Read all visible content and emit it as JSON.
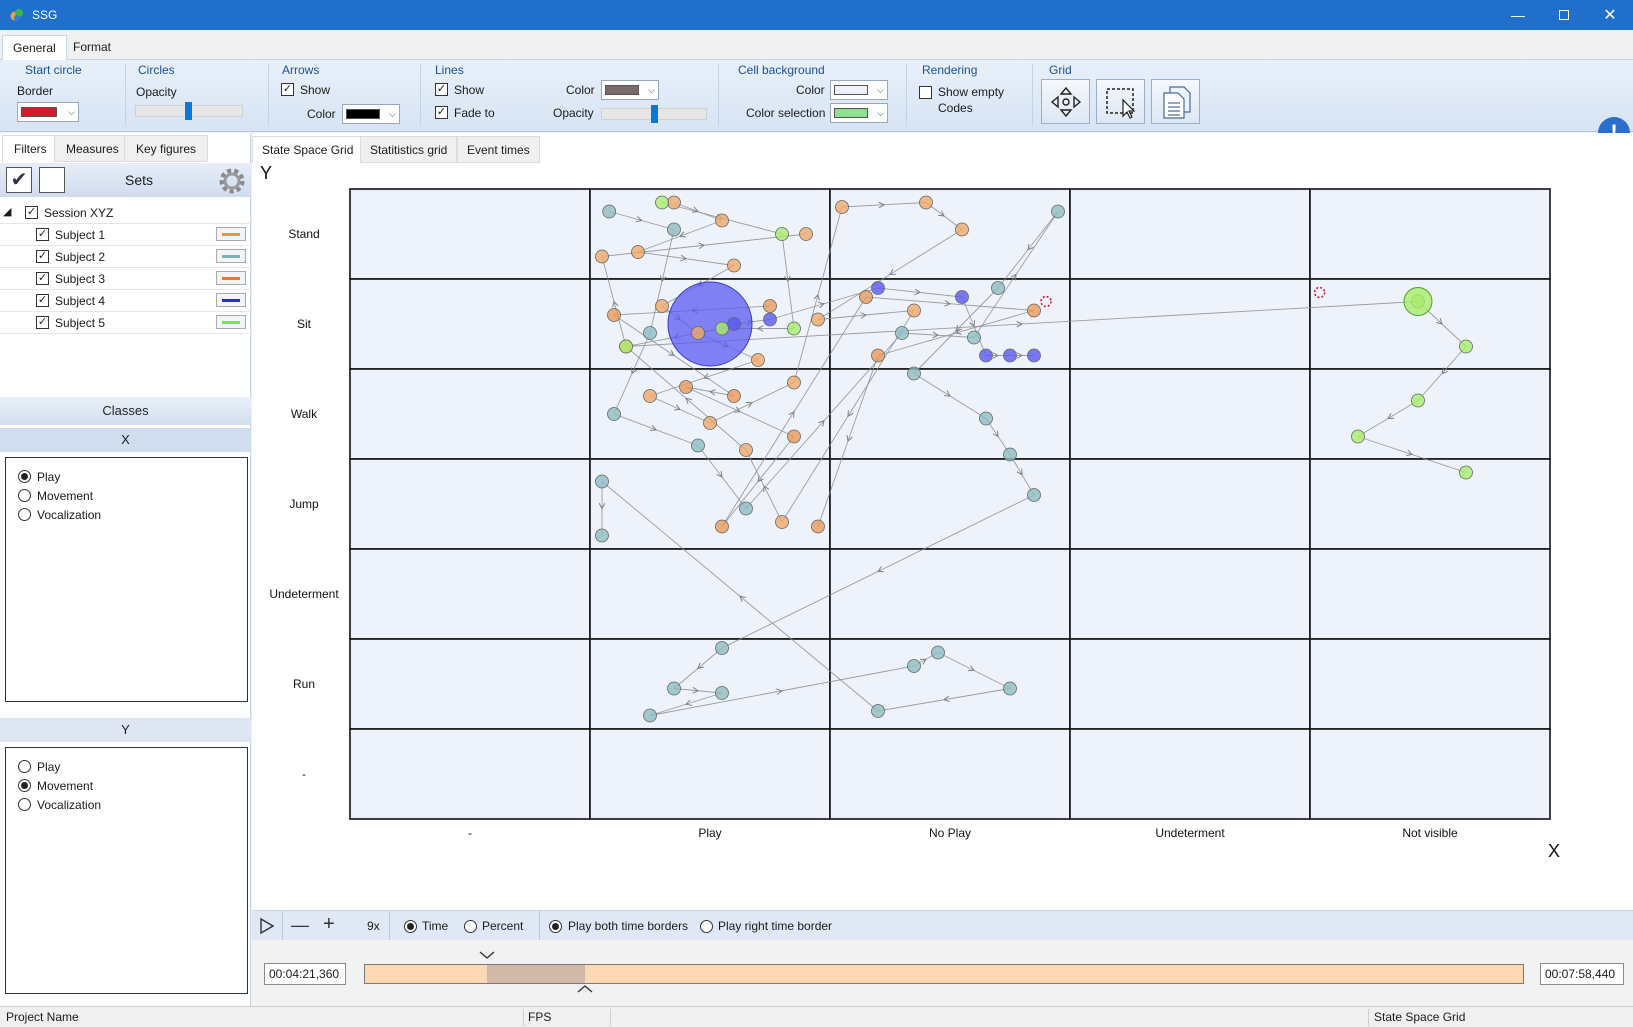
{
  "window": {
    "title": "SSG",
    "controls": [
      "minimize",
      "maximize",
      "close"
    ]
  },
  "ribbon_tabs": [
    {
      "label": "General",
      "active": true
    },
    {
      "label": "Format",
      "active": false
    }
  ],
  "ribbon": {
    "start_circle": {
      "title": "Start circle",
      "border_label": "Border",
      "border_color": "#d11a2a"
    },
    "circles": {
      "title": "Circles",
      "opacity_label": "Opacity",
      "opacity": 0.5
    },
    "arrows": {
      "title": "Arrows",
      "show_label": "Show",
      "show": true,
      "color_label": "Color",
      "color": "#000000"
    },
    "lines": {
      "title": "Lines",
      "show_label": "Show",
      "show": true,
      "fade_label": "Fade to",
      "fade": true,
      "color_label": "Color",
      "color": "#7b6a6a",
      "opacity_label": "Opacity",
      "opacity": 0.5
    },
    "cell_background": {
      "title": "Cell background",
      "color_label": "Color",
      "color": "#eef3fb",
      "selection_label": "Color selection",
      "selection_color": "#8fe08f"
    },
    "rendering": {
      "title": "Rendering",
      "show_empty_label": "Show empty Codes",
      "show_empty": false
    },
    "grid": {
      "title": "Grid",
      "buttons": [
        "move-arrows-icon",
        "select-cursor-icon",
        "copy-document-icon"
      ]
    },
    "info_icon": "exclamation-info-icon"
  },
  "left_tabs": [
    {
      "label": "Filters",
      "active": true
    },
    {
      "label": "Measures",
      "active": false
    },
    {
      "label": "Key figures",
      "active": false
    }
  ],
  "sets": {
    "title": "Sets",
    "session": "Session XYZ",
    "subjects": [
      {
        "label": "Subject 1",
        "checked": true,
        "color": "#e8943a"
      },
      {
        "label": "Subject 2",
        "checked": true,
        "color": "#7fb0b8"
      },
      {
        "label": "Subject 3",
        "checked": true,
        "color": "#e07a3a"
      },
      {
        "label": "Subject 4",
        "checked": true,
        "color": "#2b2bd6"
      },
      {
        "label": "Subject 5",
        "checked": true,
        "color": "#7ee04a"
      }
    ]
  },
  "classes": {
    "title": "Classes",
    "x": {
      "label": "X",
      "options": [
        "Play",
        "Movement",
        "Vocalization"
      ],
      "selected": "Play"
    },
    "y": {
      "label": "Y",
      "options": [
        "Play",
        "Movement",
        "Vocalization"
      ],
      "selected": "Movement"
    }
  },
  "main_tabs": [
    {
      "label": "State Space Grid",
      "active": true
    },
    {
      "label": "Statitistics grid",
      "active": false
    },
    {
      "label": "Event times",
      "active": false
    }
  ],
  "chart_data": {
    "type": "scatter",
    "xlabel": "X",
    "ylabel": "Y",
    "x_categories": [
      "-",
      "Play",
      "No Play",
      "Undeterment",
      "Not visible"
    ],
    "y_categories": [
      "Stand",
      "Sit",
      "Walk",
      "Jump",
      "Undeterment",
      "Run",
      "-"
    ],
    "series": [
      {
        "name": "Subject 1",
        "color": "#f0a86a",
        "points": [
          [
            1.35,
            0.15
          ],
          [
            1.55,
            0.35
          ],
          [
            1.2,
            0.7
          ],
          [
            1.6,
            0.85
          ],
          [
            1.3,
            1.3
          ],
          [
            1.45,
            1.6
          ],
          [
            1.7,
            1.9
          ],
          [
            1.25,
            2.3
          ],
          [
            1.5,
            2.6
          ],
          [
            1.85,
            2.15
          ],
          [
            2.05,
            0.2
          ],
          [
            2.4,
            0.15
          ],
          [
            2.55,
            0.45
          ],
          [
            1.95,
            1.45
          ],
          [
            2.35,
            1.35
          ],
          [
            1.8,
            3.7
          ],
          [
            1.65,
            2.9
          ],
          [
            1.15,
            1.75
          ],
          [
            1.05,
            0.75
          ],
          [
            1.9,
            0.5
          ]
        ]
      },
      {
        "name": "Subject 2",
        "color": "#8fbcc2",
        "points": [
          [
            1.08,
            0.25
          ],
          [
            1.35,
            0.45
          ],
          [
            1.25,
            1.6
          ],
          [
            1.1,
            2.5
          ],
          [
            1.45,
            2.85
          ],
          [
            1.65,
            3.55
          ],
          [
            2.3,
            1.6
          ],
          [
            2.6,
            1.65
          ],
          [
            2.95,
            0.25
          ],
          [
            2.7,
            1.1
          ],
          [
            2.35,
            2.05
          ],
          [
            2.65,
            2.55
          ],
          [
            2.75,
            2.95
          ],
          [
            2.85,
            3.4
          ],
          [
            1.55,
            5.1
          ],
          [
            1.35,
            5.55
          ],
          [
            1.55,
            5.6
          ],
          [
            1.25,
            5.85
          ],
          [
            2.35,
            5.3
          ],
          [
            2.45,
            5.15
          ],
          [
            2.75,
            5.55
          ],
          [
            2.2,
            5.8
          ],
          [
            1.05,
            3.25
          ],
          [
            1.05,
            3.85
          ]
        ]
      },
      {
        "name": "Subject 3",
        "color": "#e89a5a",
        "points": [
          [
            1.75,
            1.3
          ],
          [
            1.1,
            1.4
          ],
          [
            1.6,
            2.3
          ],
          [
            1.4,
            2.2
          ],
          [
            1.85,
            2.75
          ],
          [
            1.55,
            3.75
          ],
          [
            2.15,
            1.2
          ],
          [
            2.85,
            1.35
          ],
          [
            2.2,
            1.85
          ],
          [
            1.95,
            3.75
          ]
        ]
      },
      {
        "name": "Subject 4",
        "color": "#5a5af0",
        "points": [
          [
            1.6,
            1.5
          ],
          [
            1.75,
            1.45
          ],
          [
            2.2,
            1.1
          ],
          [
            2.55,
            1.2
          ],
          [
            2.65,
            1.85
          ],
          [
            2.75,
            1.85
          ],
          [
            2.85,
            1.85
          ]
        ]
      },
      {
        "name": "Subject 5",
        "color": "#a8ec6a",
        "points": [
          [
            1.3,
            0.15
          ],
          [
            1.8,
            0.5
          ],
          [
            1.85,
            1.55
          ],
          [
            1.55,
            1.55
          ],
          [
            1.15,
            1.75
          ],
          [
            4.45,
            1.25
          ],
          [
            4.65,
            1.75
          ],
          [
            4.45,
            2.35
          ],
          [
            4.2,
            2.75
          ],
          [
            4.65,
            3.15
          ]
        ]
      }
    ],
    "big_circle": {
      "x": 1.5,
      "y": 1.5,
      "series": "Subject 4"
    },
    "grid": true
  },
  "playbar": {
    "play_icon": "play-icon",
    "zoom_out_icon": "minus-icon",
    "zoom_in_icon": "plus-icon",
    "speed": "9x",
    "mode_options": [
      "Time",
      "Percent"
    ],
    "mode_selected": "Time",
    "border_options": [
      "Play both time borders",
      "Play right time border"
    ],
    "border_selected": "Play both time borders"
  },
  "timeline": {
    "start": "00:04:21,360",
    "end": "00:07:58,440",
    "window_start": 0.105,
    "window_end": 0.19
  },
  "statusbar": {
    "project": "Project Name",
    "fps": "FPS",
    "view": "State Space Grid"
  }
}
